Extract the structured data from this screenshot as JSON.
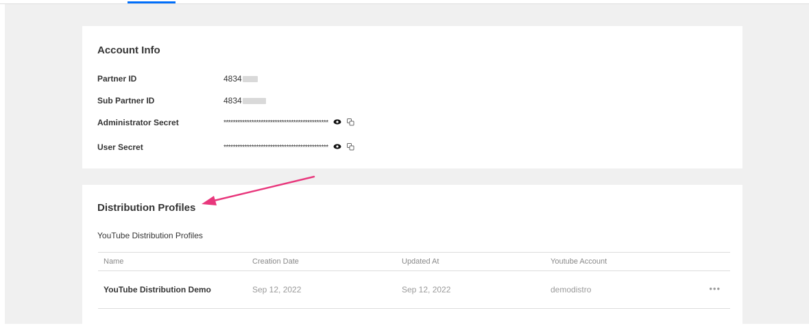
{
  "account_info": {
    "title": "Account Info",
    "fields": [
      {
        "label": "Partner ID",
        "value": "4834"
      },
      {
        "label": "Sub Partner ID",
        "value": "4834"
      },
      {
        "label": "Administrator Secret",
        "value": "*********************************************"
      },
      {
        "label": "User Secret",
        "value": "*********************************************"
      }
    ]
  },
  "distribution_profiles": {
    "title": "Distribution Profiles",
    "subtitle": "YouTube Distribution Profiles",
    "columns": [
      "Name",
      "Creation Date",
      "Updated At",
      "Youtube Account"
    ],
    "rows": [
      {
        "name": "YouTube Distribution Demo",
        "creation_date": "Sep 12, 2022",
        "updated_at": "Sep 12, 2022",
        "youtube_account": "demodistro",
        "actions": "•••"
      }
    ]
  },
  "colors": {
    "accent": "#006efa",
    "annotation_arrow": "#e8377c",
    "background": "#f0f0f0"
  },
  "icons": [
    "eye-icon",
    "copy-icon",
    "more-icon"
  ]
}
